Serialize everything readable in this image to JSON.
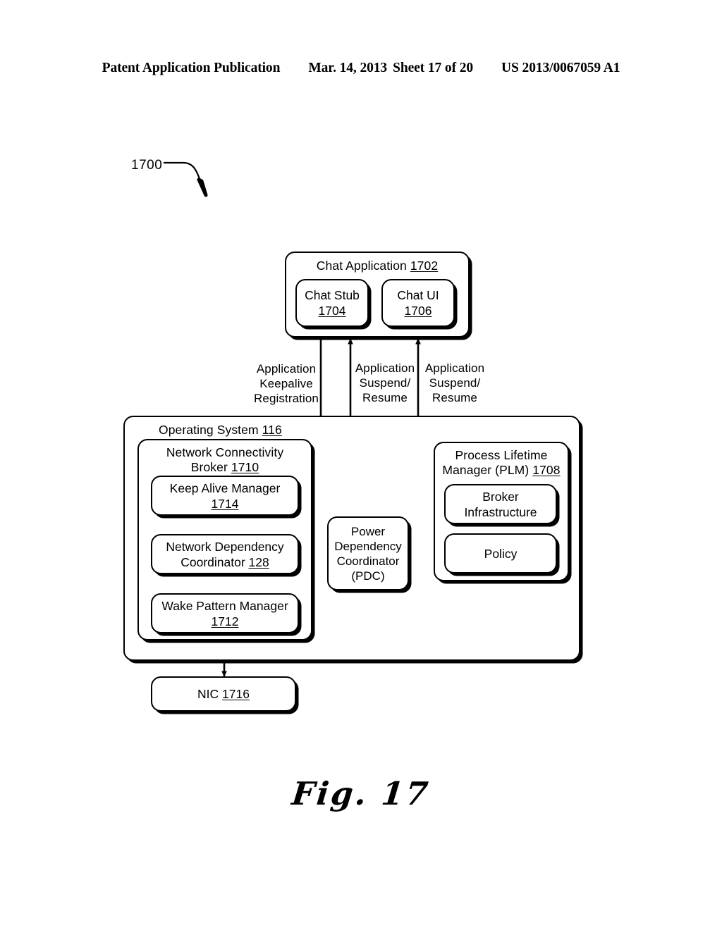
{
  "header": {
    "publication": "Patent Application Publication",
    "date": "Mar. 14, 2013",
    "sheet": "Sheet 17 of 20",
    "patent_number": "US 2013/0067059 A1"
  },
  "figure": {
    "caption": "Fig. 17",
    "reference_numeral": "1700"
  },
  "diagram": {
    "chat_application": {
      "title": "Chat Application ",
      "ref": "1702",
      "children": [
        {
          "label": "Chat Stub",
          "ref": "1704"
        },
        {
          "label": "Chat UI",
          "ref": "1706"
        }
      ]
    },
    "wire_labels": [
      "Application\nKeepalive\nRegistration",
      "Application\nSuspend/\nResume",
      "Application\nSuspend/\nResume"
    ],
    "operating_system": {
      "title": "Operating System ",
      "ref": "116"
    },
    "network_connectivity_broker": {
      "title_line1": "Network Connectivity",
      "title_line2": "Broker ",
      "ref": "1710",
      "children": [
        {
          "label": "Keep Alive Manager",
          "ref": "1714"
        },
        {
          "label_line1": "Network Dependency",
          "label_line2": "Coordinator ",
          "ref": "128"
        },
        {
          "label": "Wake Pattern Manager",
          "ref": "1712"
        }
      ]
    },
    "power_dependency_coordinator": {
      "label": "Power\nDependency\nCoordinator\n(PDC)"
    },
    "process_lifetime_manager": {
      "title_line1": "Process Lifetime",
      "title_line2": "Manager (PLM) ",
      "ref": "1708",
      "children": [
        {
          "label": "Broker\nInfrastructure"
        },
        {
          "label": "Policy"
        }
      ]
    },
    "nic": {
      "label": "NIC ",
      "ref": "1716"
    }
  }
}
